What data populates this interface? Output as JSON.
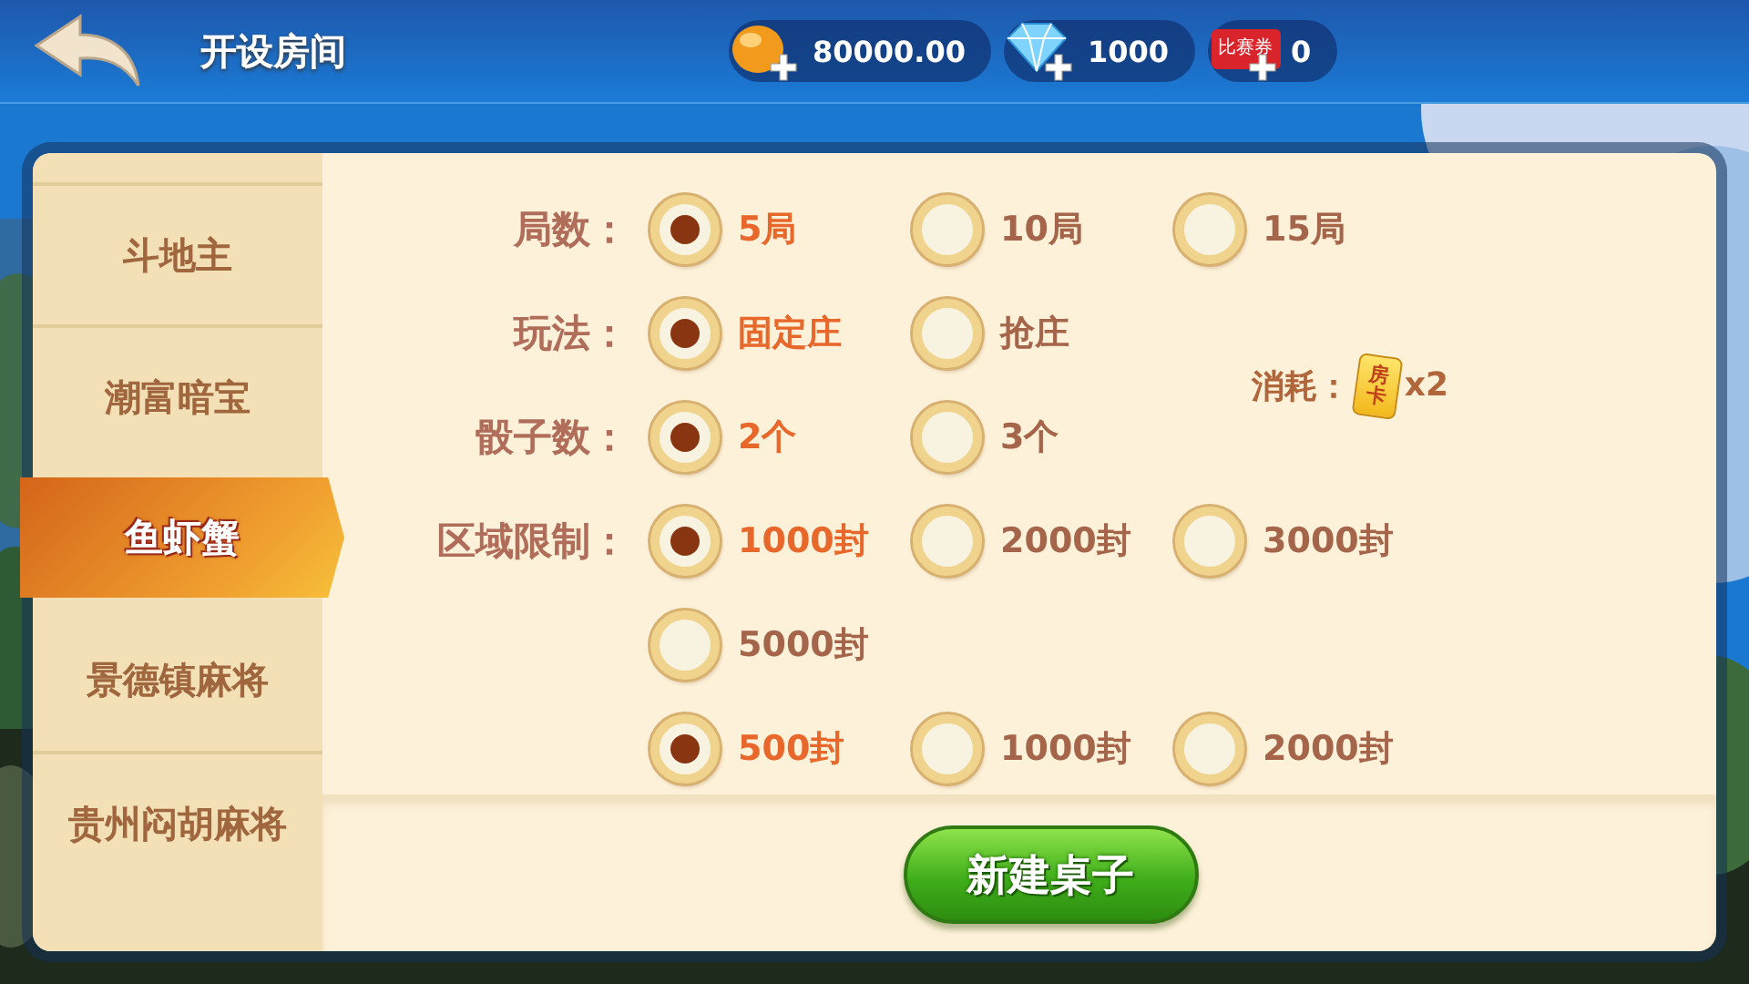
{
  "top_bar": {
    "title": "开设房间",
    "currencies": [
      {
        "kind": "gold",
        "value": "80000.00"
      },
      {
        "kind": "diamond",
        "value": "1000"
      },
      {
        "kind": "ticket",
        "icon_text": "比赛券",
        "value": "0"
      }
    ]
  },
  "sidebar": {
    "items": [
      {
        "label": "斗地主",
        "selected": false
      },
      {
        "label": "潮富暗宝",
        "selected": false
      },
      {
        "label": "鱼虾蟹",
        "selected": true
      },
      {
        "label": "景德镇麻将",
        "selected": false
      },
      {
        "label": "贵州闷胡麻将",
        "selected": false
      }
    ]
  },
  "settings": {
    "groups": [
      {
        "label": "局数：",
        "options": [
          {
            "label": "5局",
            "selected": true
          },
          {
            "label": "10局",
            "selected": false
          },
          {
            "label": "15局",
            "selected": false
          }
        ]
      },
      {
        "label": "玩法：",
        "options": [
          {
            "label": "固定庄",
            "selected": true
          },
          {
            "label": "抢庄",
            "selected": false
          }
        ]
      },
      {
        "label": "骰子数：",
        "options": [
          {
            "label": "2个",
            "selected": true
          },
          {
            "label": "3个",
            "selected": false
          }
        ]
      },
      {
        "label": "区域限制：",
        "options": [
          {
            "label": "1000封",
            "selected": true
          },
          {
            "label": "2000封",
            "selected": false
          },
          {
            "label": "3000封",
            "selected": false
          },
          {
            "label": "5000封",
            "selected": false
          }
        ]
      },
      {
        "options": [
          {
            "label": "500封",
            "selected": true
          },
          {
            "label": "1000封",
            "selected": false
          },
          {
            "label": "2000封",
            "selected": false
          }
        ]
      }
    ],
    "cost": {
      "label": "消耗：",
      "card_text": "房卡",
      "multiplier": "x2"
    }
  },
  "create_button": "新建桌子"
}
